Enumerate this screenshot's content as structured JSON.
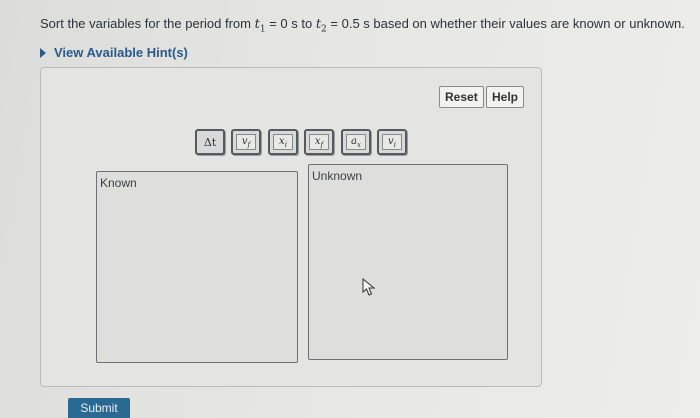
{
  "question": {
    "prefix": "Sort the variables for the period from ",
    "t1_var": "t",
    "t1_sub": "1",
    "t1_eq": " = 0 s to ",
    "t2_var": "t",
    "t2_sub": "2",
    "t2_eq": " = 0.5 s based on whether their values are known or unknown."
  },
  "hint": {
    "label": "View Available Hint(s)"
  },
  "toolbar": {
    "reset_label": "Reset",
    "help_label": "Help"
  },
  "tiles": [
    {
      "label": "Δt"
    },
    {
      "label": "v_f"
    },
    {
      "label": "x_i"
    },
    {
      "label": "x_f"
    },
    {
      "label": "a_x"
    },
    {
      "label": "v_i"
    }
  ],
  "bins": {
    "known_label": "Known",
    "unknown_label": "Unknown"
  },
  "submit": {
    "label": "Submit"
  },
  "colors": {
    "accent": "#2a6a92",
    "hint": "#2a5a8a"
  }
}
